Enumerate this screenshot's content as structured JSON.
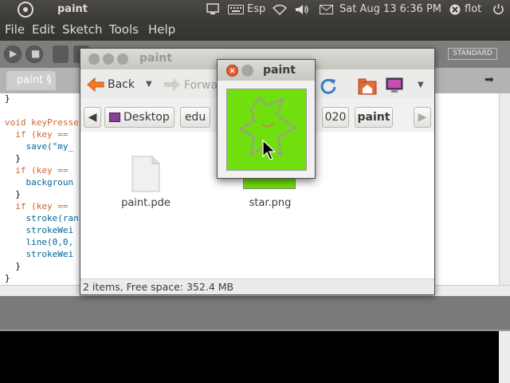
{
  "top_panel": {
    "app_name": "paint",
    "keyboard_layout": "Esp",
    "clock": "Sat Aug 13  6:36 PM",
    "user": "flot",
    "icons": [
      "ubuntu-logo-icon",
      "display-icon",
      "keyboard-icon",
      "wifi-icon",
      "volume-icon",
      "mail-icon",
      "user-x-icon",
      "power-icon"
    ]
  },
  "menubar": {
    "items": [
      "File",
      "Edit",
      "Sketch",
      "Tools",
      "Help"
    ]
  },
  "processing_toolbar": {
    "mode": "STANDARD",
    "buttons": [
      "run-icon",
      "stop-icon",
      "new-icon",
      "open-icon",
      "save-icon",
      "export-icon"
    ]
  },
  "processing_tabs": {
    "tab_label": "paint §"
  },
  "editor": {
    "lines": [
      "}",
      "",
      "void keyPresse",
      "  if (key ==",
      "    save(\"my_",
      "  }",
      "  if (key ==",
      "    backgroun",
      "  }",
      "  if (key ==",
      "    stroke(ran",
      "    strokeWei",
      "    line(0,0,",
      "    strokeWei",
      "  }",
      "}"
    ]
  },
  "file_manager": {
    "title": "paint",
    "back_label": "Back",
    "forward_label": "Forward",
    "breadcrumbs": [
      "Desktop",
      "edu",
      "020",
      "paint"
    ],
    "files": [
      {
        "name": "paint.pde",
        "icon": "text-file-icon"
      },
      {
        "name": "star.png",
        "icon": "image-file-icon"
      }
    ],
    "status": "2 items, Free space: 352.4 MB"
  },
  "image_viewer": {
    "title": "paint",
    "image_color": "#6fe00d"
  },
  "colors": {
    "panel_bg": "#3c3b37",
    "close_button": "#e35a2c",
    "image_green": "#6fe00d",
    "folder_orange": "#e16d3a"
  }
}
